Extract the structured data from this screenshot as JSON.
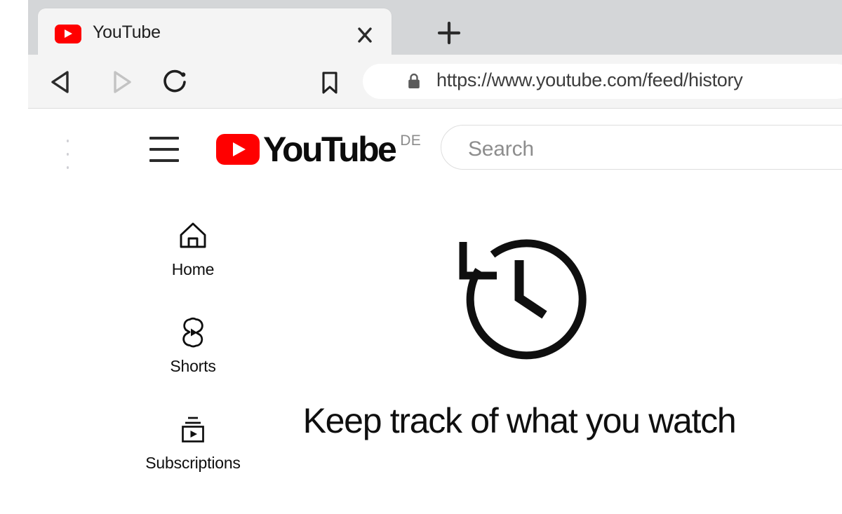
{
  "browser": {
    "tab": {
      "title": "YouTube",
      "favicon": "youtube-favicon",
      "close_icon": "close-icon"
    },
    "new_tab_icon": "plus-icon",
    "toolbar": {
      "back_icon": "back-arrow-icon",
      "forward_icon": "forward-arrow-icon",
      "reload_icon": "reload-icon",
      "bookmark_icon": "bookmark-icon",
      "lock_icon": "lock-icon",
      "url": "https://www.youtube.com/feed/history"
    }
  },
  "youtube": {
    "masthead": {
      "overflow_icon": "vertical-dots-icon",
      "guide_icon": "hamburger-menu-icon",
      "logo_text": "YouTube",
      "logo_mark": "youtube-play-logo",
      "country_code": "DE",
      "search_placeholder": "Search"
    },
    "guide": {
      "items": [
        {
          "label": "Home",
          "icon": "home-icon"
        },
        {
          "label": "Shorts",
          "icon": "shorts-icon"
        },
        {
          "label": "Subscriptions",
          "icon": "subscriptions-icon"
        }
      ]
    },
    "empty_state": {
      "icon": "history-clock-icon",
      "heading": "Keep track of what you watch"
    }
  },
  "colors": {
    "youtube_red": "#ff0000",
    "tabstrip_grey": "#d4d6d8",
    "toolbar_grey": "#f4f4f4",
    "text_primary": "#0f0f0f",
    "text_muted": "#8d8d8d"
  }
}
